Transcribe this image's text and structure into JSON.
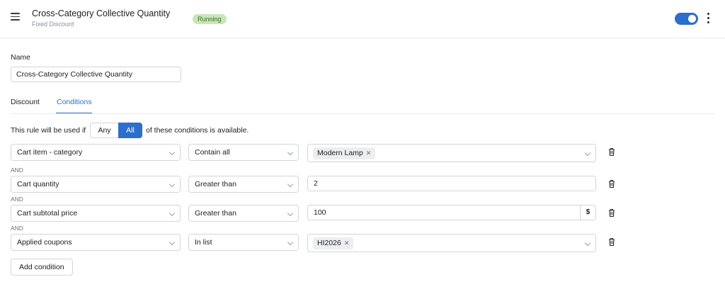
{
  "header": {
    "title": "Cross-Category Collective Quantity",
    "subtitle": "Fixed Discount",
    "status": "Running",
    "enabled": true
  },
  "form": {
    "name_label": "Name",
    "name_value": "Cross-Category Collective Quantity"
  },
  "tabs": [
    {
      "label": "Discount",
      "active": false
    },
    {
      "label": "Conditions",
      "active": true
    }
  ],
  "rule": {
    "prefix": "This rule will be used if",
    "options": [
      "Any",
      "All"
    ],
    "selected": "All",
    "suffix": "of these conditions is available."
  },
  "conditions": [
    {
      "field": "Cart item - category",
      "operator": "Contain all",
      "tags": [
        "Modern Lamp"
      ]
    },
    {
      "field": "Cart quantity",
      "operator": "Greater than",
      "value": "2"
    },
    {
      "field": "Cart subtotal price",
      "operator": "Greater than",
      "value": "100",
      "value_suffix": "$"
    },
    {
      "field": "Applied coupons",
      "operator": "In list",
      "tags": [
        "HI2026"
      ]
    }
  ],
  "connector": "AND",
  "add_condition_label": "Add condition",
  "colors": {
    "accent": "#2c6ecb",
    "badge_bg": "#c8e6b8",
    "badge_text": "#3d6e2c"
  },
  "icons": {
    "menu": "menu-icon",
    "more": "more-vertical-icon",
    "delete": "trash-icon",
    "dropdown": "chevron-down-icon",
    "remove_tag": "close-icon"
  }
}
